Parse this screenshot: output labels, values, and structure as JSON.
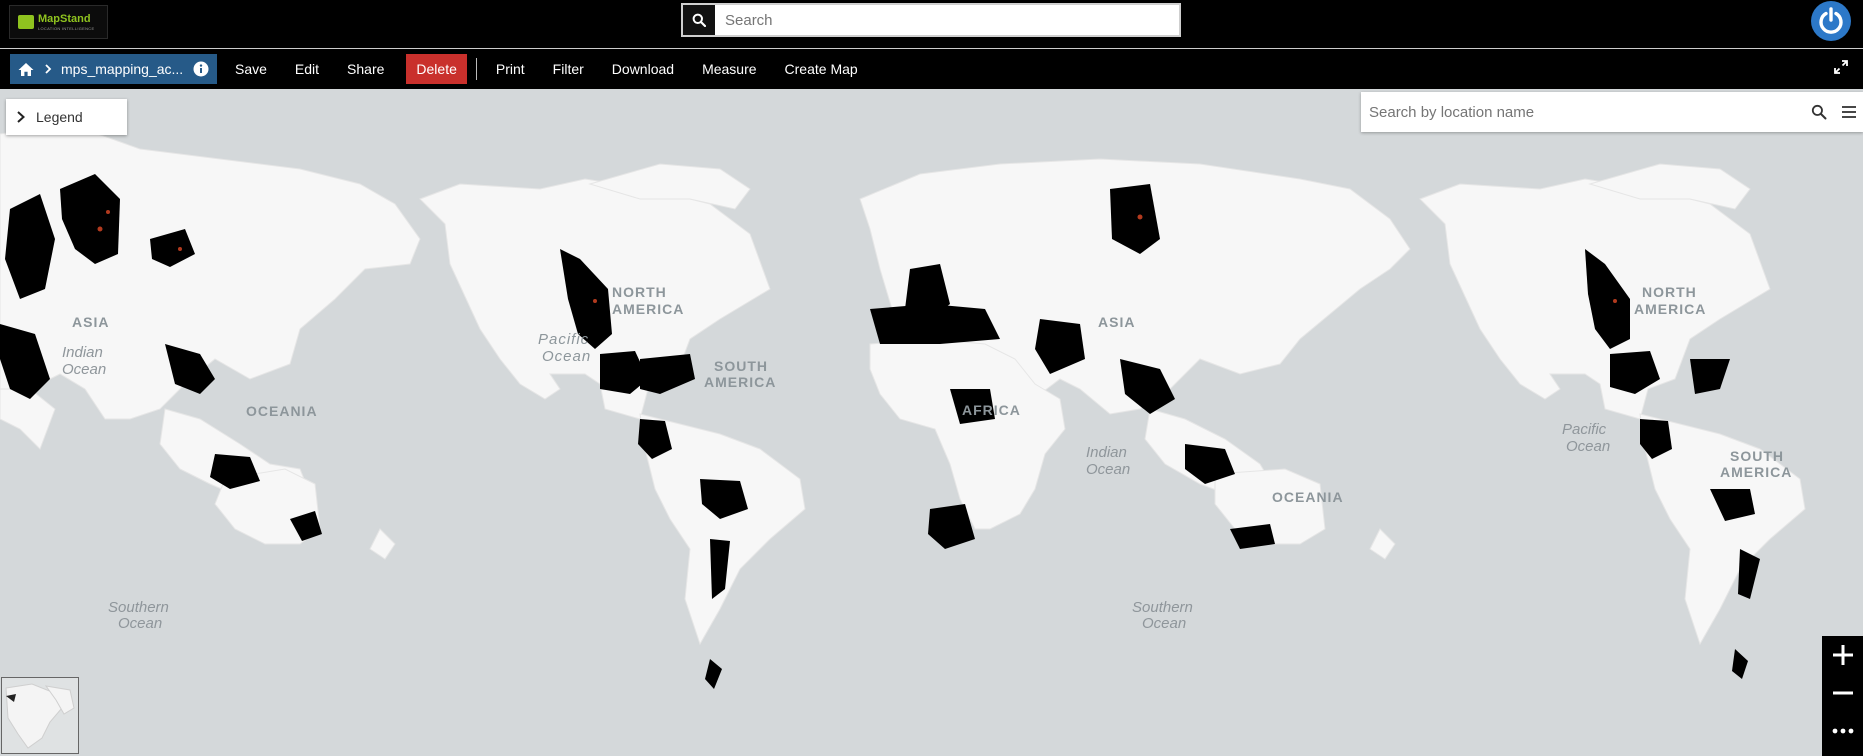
{
  "header": {
    "logo": {
      "name": "MapStand",
      "tagline": "LOCATION INTELLIGENCE"
    },
    "search": {
      "placeholder": "Search",
      "value": ""
    }
  },
  "toolbar": {
    "breadcrumb": {
      "map_name": "mps_mapping_ac..."
    },
    "buttons": {
      "save": "Save",
      "edit": "Edit",
      "share": "Share",
      "delete": "Delete",
      "print": "Print",
      "filter": "Filter",
      "download": "Download",
      "measure": "Measure",
      "create_map": "Create Map"
    }
  },
  "map": {
    "legend": {
      "label": "Legend"
    },
    "location_search": {
      "placeholder": "Search by location name"
    },
    "labels": {
      "asia": "ASIA",
      "north_america_1": "NORTH",
      "north_america_2": "AMERICA",
      "africa": "AFRICA",
      "south_america_1": "SOUTH",
      "south_america_2": "AMERICA",
      "oceania": "OCEANIA",
      "indian_ocean_1": "Indian",
      "indian_ocean_2": "Ocean",
      "pacific_ocean_1": "Pacific",
      "pacific_ocean_2": "Ocean",
      "southern_ocean_1": "Southern",
      "southern_ocean_2": "Ocean"
    },
    "colors": {
      "ocean": "#d4d8da",
      "land": "#f7f7f7",
      "feature": "#000000",
      "accent": "#b23a1e"
    }
  },
  "icons": {
    "search": "search-icon",
    "power": "power-icon",
    "home": "home-icon",
    "info": "info-icon",
    "expand": "expand-icon",
    "chevron": "chevron-right-icon",
    "menu": "menu-icon",
    "zoom_in": "plus-icon",
    "zoom_out": "minus-icon",
    "more": "more-icon"
  }
}
